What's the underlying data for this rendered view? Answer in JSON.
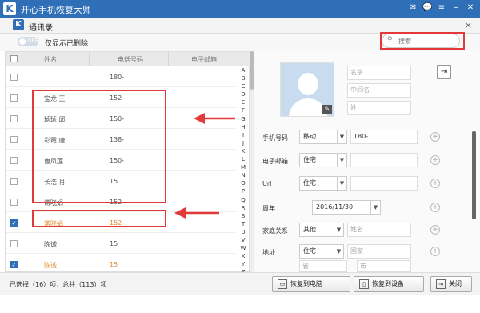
{
  "app": {
    "title": "开心手机恢复大师",
    "logo": "K"
  },
  "window": {
    "title": "通讯录",
    "close": "×"
  },
  "toolbar": {
    "toggle_label": "OFF",
    "only_deleted_label": "仅显示已删除"
  },
  "search": {
    "placeholder": "搜索"
  },
  "table": {
    "headers": {
      "name": "姓名",
      "phone": "电话号码",
      "email": "电子邮箱"
    },
    "rows": [
      {
        "name": "",
        "phone": "180-",
        "checked": false,
        "highlight": false
      },
      {
        "name": "宝龙 王",
        "phone": "152-",
        "checked": false,
        "highlight": false
      },
      {
        "name": "琥琥 邱",
        "phone": "150-",
        "checked": false,
        "highlight": false
      },
      {
        "name": "彩霞 唐",
        "phone": "138-",
        "checked": false,
        "highlight": false
      },
      {
        "name": "曹凤莲",
        "phone": "150-",
        "checked": false,
        "highlight": false
      },
      {
        "name": "长浩 肖",
        "phone": "15",
        "checked": false,
        "highlight": false
      },
      {
        "name": "常晓娟",
        "phone": "152",
        "checked": false,
        "highlight": false
      },
      {
        "name": "常晓娟",
        "phone": "152-",
        "checked": true,
        "highlight": true
      },
      {
        "name": "陈诚",
        "phone": "15",
        "checked": false,
        "highlight": false
      },
      {
        "name": "陈诚",
        "phone": "15",
        "checked": true,
        "highlight": true
      }
    ],
    "alphabet": [
      "A",
      "B",
      "C",
      "D",
      "E",
      "F",
      "G",
      "H",
      "I",
      "J",
      "K",
      "L",
      "M",
      "N",
      "O",
      "P",
      "Q",
      "R",
      "S",
      "T",
      "U",
      "V",
      "W",
      "X",
      "Y",
      "Z"
    ]
  },
  "detail": {
    "name_placeholder": "名字",
    "middle_placeholder": "中间名",
    "surname_placeholder": "姓",
    "phone": {
      "label": "手机号码",
      "type": "移动",
      "value": "180-"
    },
    "email": {
      "label": "电子邮箱",
      "type": "住宅"
    },
    "url": {
      "label": "Url",
      "type": "住宅"
    },
    "anniversary": {
      "label": "周年",
      "value": "2016/11/30"
    },
    "family": {
      "label": "家庭关系",
      "type": "其他",
      "placeholder": "姓名"
    },
    "address": {
      "label": "地址",
      "type": "住宅",
      "country_placeholder": "国家",
      "province_placeholder": "省",
      "city_placeholder": "市"
    }
  },
  "footer": {
    "status": "已选择（16）项，总共（113）项",
    "restore_pc": "恢复到电脑",
    "restore_device": "恢复到设备",
    "close": "关闭"
  },
  "colors": {
    "accent": "#2f6fb8",
    "highlight": "#e23a3a",
    "orange_text": "#e08a2c"
  }
}
